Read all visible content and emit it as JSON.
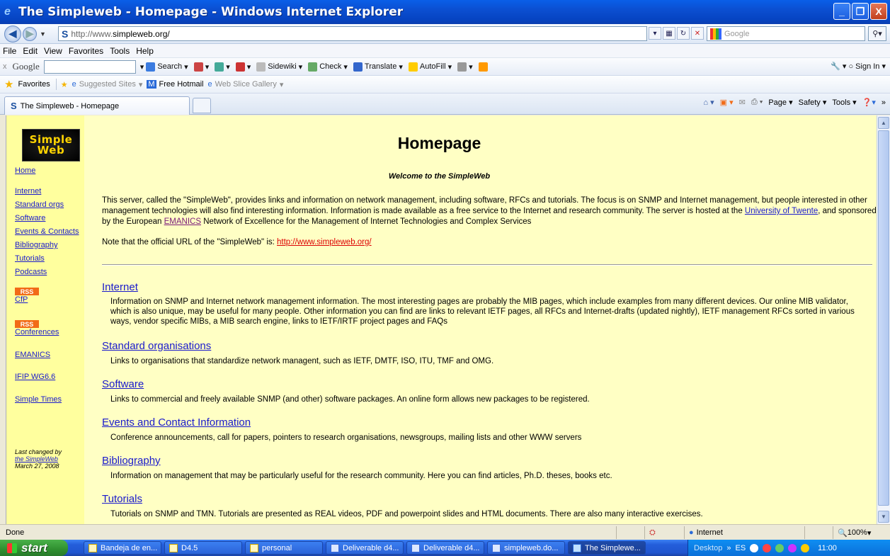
{
  "window": {
    "title": "The Simpleweb - Homepage - Windows Internet Explorer",
    "minimize": "_",
    "maximize": "❐",
    "close": "X"
  },
  "address": {
    "url_prefix": "http://www.",
    "url_domain": "simpleweb.org/",
    "search_placeholder": "Google"
  },
  "menu": [
    "File",
    "Edit",
    "View",
    "Favorites",
    "Tools",
    "Help"
  ],
  "google_toolbar": {
    "logo": "Google",
    "close": "x",
    "items": [
      {
        "label": "Search",
        "icon": "google-search-icon",
        "color": "#3a7be0"
      },
      {
        "label": "",
        "icon": "popup-icon",
        "color": "#c44"
      },
      {
        "label": "",
        "icon": "plus-icon",
        "color": "#4a9"
      },
      {
        "label": "",
        "icon": "share-icon",
        "color": "#c33"
      },
      {
        "label": "Sidewiki",
        "icon": "sidewiki-icon",
        "color": "#bbb"
      },
      {
        "label": "Check",
        "icon": "spellcheck-icon",
        "color": "#6a6"
      },
      {
        "label": "Translate",
        "icon": "translate-icon",
        "color": "#36c"
      },
      {
        "label": "AutoFill",
        "icon": "autofill-icon",
        "color": "#fc0"
      },
      {
        "label": "",
        "icon": "wrench-icon",
        "color": "#999"
      },
      {
        "label": "",
        "icon": "pencil-icon",
        "color": "#f90"
      }
    ],
    "signin": "Sign In"
  },
  "favorites": {
    "label": "Favorites",
    "items": [
      "Suggested Sites",
      "Free Hotmail",
      "Web Slice Gallery"
    ]
  },
  "tab": {
    "label": "The Simpleweb - Homepage"
  },
  "command_bar": [
    "Page",
    "Safety",
    "Tools"
  ],
  "sidebar": {
    "logo_line1": "Simple",
    "logo_line2": "Web",
    "links": {
      "home": "Home",
      "internet": "Internet",
      "standard": "Standard orgs",
      "software": "Software",
      "events": "Events & Contacts",
      "biblio": "Bibliography",
      "tutorials": "Tutorials",
      "podcasts": "Podcasts",
      "cfp": "CfP",
      "conferences": "Conferences",
      "emanics": "EMANICS",
      "ifip": "IFIP WG6.6",
      "times": "Simple Times"
    },
    "rss": "RSS",
    "changed_line1": "Last changed by",
    "changed_link": "the SimpleWeb",
    "changed_date": "March 27, 2008"
  },
  "page": {
    "title": "Homepage",
    "welcome": "Welcome to the SimpleWeb",
    "intro_1": "This server, called the \"SimpleWeb\", provides links and information on network management, including software, RFCs and tutorials. The focus is on SNMP and Internet management, but people interested in other management technologies will also find interesting information. Information is made available as a free service to the Internet and research community. The server is hosted at the ",
    "intro_link1": "University of Twente",
    "intro_2": ", and sponsored by the European ",
    "intro_link2": "EMANICS",
    "intro_3": " Network of Excellence for the Management of Internet Technologies and Complex Services",
    "note": "Note that the official URL of the \"SimpleWeb\" is: ",
    "note_link": "http://www.simpleweb.org/",
    "sections": [
      {
        "title": "Internet",
        "desc": "Information on SNMP and Internet network management information. The most interesting pages are probably the MIB pages, which include examples from many different devices. Our online MIB validator, which is also unique, may be useful for many people. Other information you can find are links to relevant IETF pages, all RFCs and Internet-drafts (updated nightly), IETF management RFCs sorted in various ways, vendor specific MIBs, a MIB search engine, links to IETF/IRTF project pages and FAQs"
      },
      {
        "title": "Standard organisations",
        "desc": "Links to organisations that standardize network managent, such as IETF, DMTF, ISO, ITU, TMF and OMG."
      },
      {
        "title": "Software",
        "desc": "Links to commercial and freely available SNMP (and other) software packages. An online form allows new packages to be registered."
      },
      {
        "title": "Events and Contact Information",
        "desc": "Conference announcements, call for papers, pointers to research organisations, newsgroups, mailing lists and other WWW servers"
      },
      {
        "title": "Bibliography",
        "desc": "Information on management that may be particularly useful for the research community. Here you can find articles, Ph.D. theses, books etc."
      },
      {
        "title": "Tutorials",
        "desc": "Tutorials on SNMP and TMN. Tutorials are presented as REAL videos, PDF and powerpoint slides and HTML documents. There are also many interactive exercises."
      }
    ]
  },
  "status": {
    "text": "Done",
    "zone": "Internet",
    "zoom": "100%"
  },
  "taskbar": {
    "start": "start",
    "tasks": [
      "Bandeja de en...",
      "D4.5",
      "personal",
      "Deliverable d4...",
      "Deliverable d4...",
      "simpleweb.do...",
      "The Simplewe..."
    ],
    "desktop": "Desktop",
    "lang": "ES",
    "clock": "11:00"
  }
}
